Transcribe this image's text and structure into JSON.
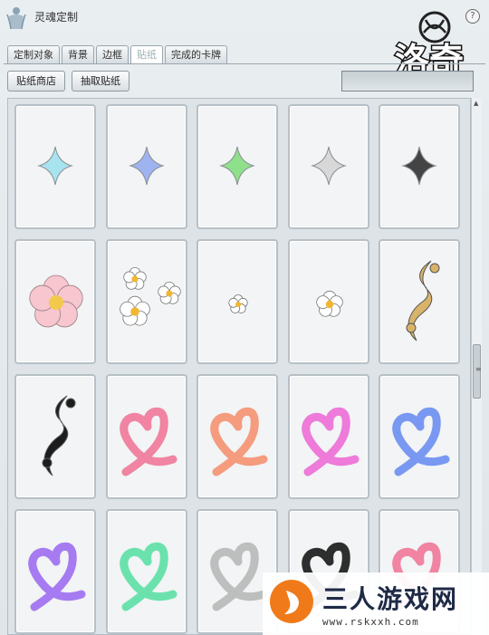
{
  "window": {
    "title": "灵魂定制",
    "help_label": "?"
  },
  "logo": {
    "text": "洛奇"
  },
  "tabs": [
    {
      "label": "定制对象",
      "active": false
    },
    {
      "label": "背景",
      "active": false
    },
    {
      "label": "边框",
      "active": false
    },
    {
      "label": "贴纸",
      "active": true
    },
    {
      "label": "完成的卡牌",
      "active": false
    }
  ],
  "buttons": {
    "shop": "贴纸商店",
    "draw": "抽取贴纸"
  },
  "search": {
    "value": ""
  },
  "stickers": [
    {
      "kind": "star",
      "color": "#a8e4f0"
    },
    {
      "kind": "star",
      "color": "#9fb3ef"
    },
    {
      "kind": "star",
      "color": "#8fe08a"
    },
    {
      "kind": "star",
      "color": "#d8d8d8"
    },
    {
      "kind": "star",
      "color": "#444444"
    },
    {
      "kind": "blossom",
      "color": "#f7c6cf"
    },
    {
      "kind": "daisies",
      "color": "#ffffff"
    },
    {
      "kind": "daisy-small",
      "color": "#ffffff"
    },
    {
      "kind": "daisy",
      "color": "#ffffff"
    },
    {
      "kind": "swirl",
      "color": "#d9b36a"
    },
    {
      "kind": "swirl",
      "color": "#1c1c1c"
    },
    {
      "kind": "heart",
      "color": "#f07a9a"
    },
    {
      "kind": "heart",
      "color": "#f59273"
    },
    {
      "kind": "heart",
      "color": "#ee6fd6"
    },
    {
      "kind": "heart",
      "color": "#6f8ff0"
    },
    {
      "kind": "heart",
      "color": "#a070f0"
    },
    {
      "kind": "heart",
      "color": "#5fe0a6"
    },
    {
      "kind": "heart",
      "color": "#b9b9b9"
    },
    {
      "kind": "heart",
      "color": "#1c1c1c"
    },
    {
      "kind": "heart",
      "color": "#f07a9a"
    }
  ],
  "watermark": {
    "title": "三人游戏网",
    "url": "www.rskxxh.com"
  }
}
